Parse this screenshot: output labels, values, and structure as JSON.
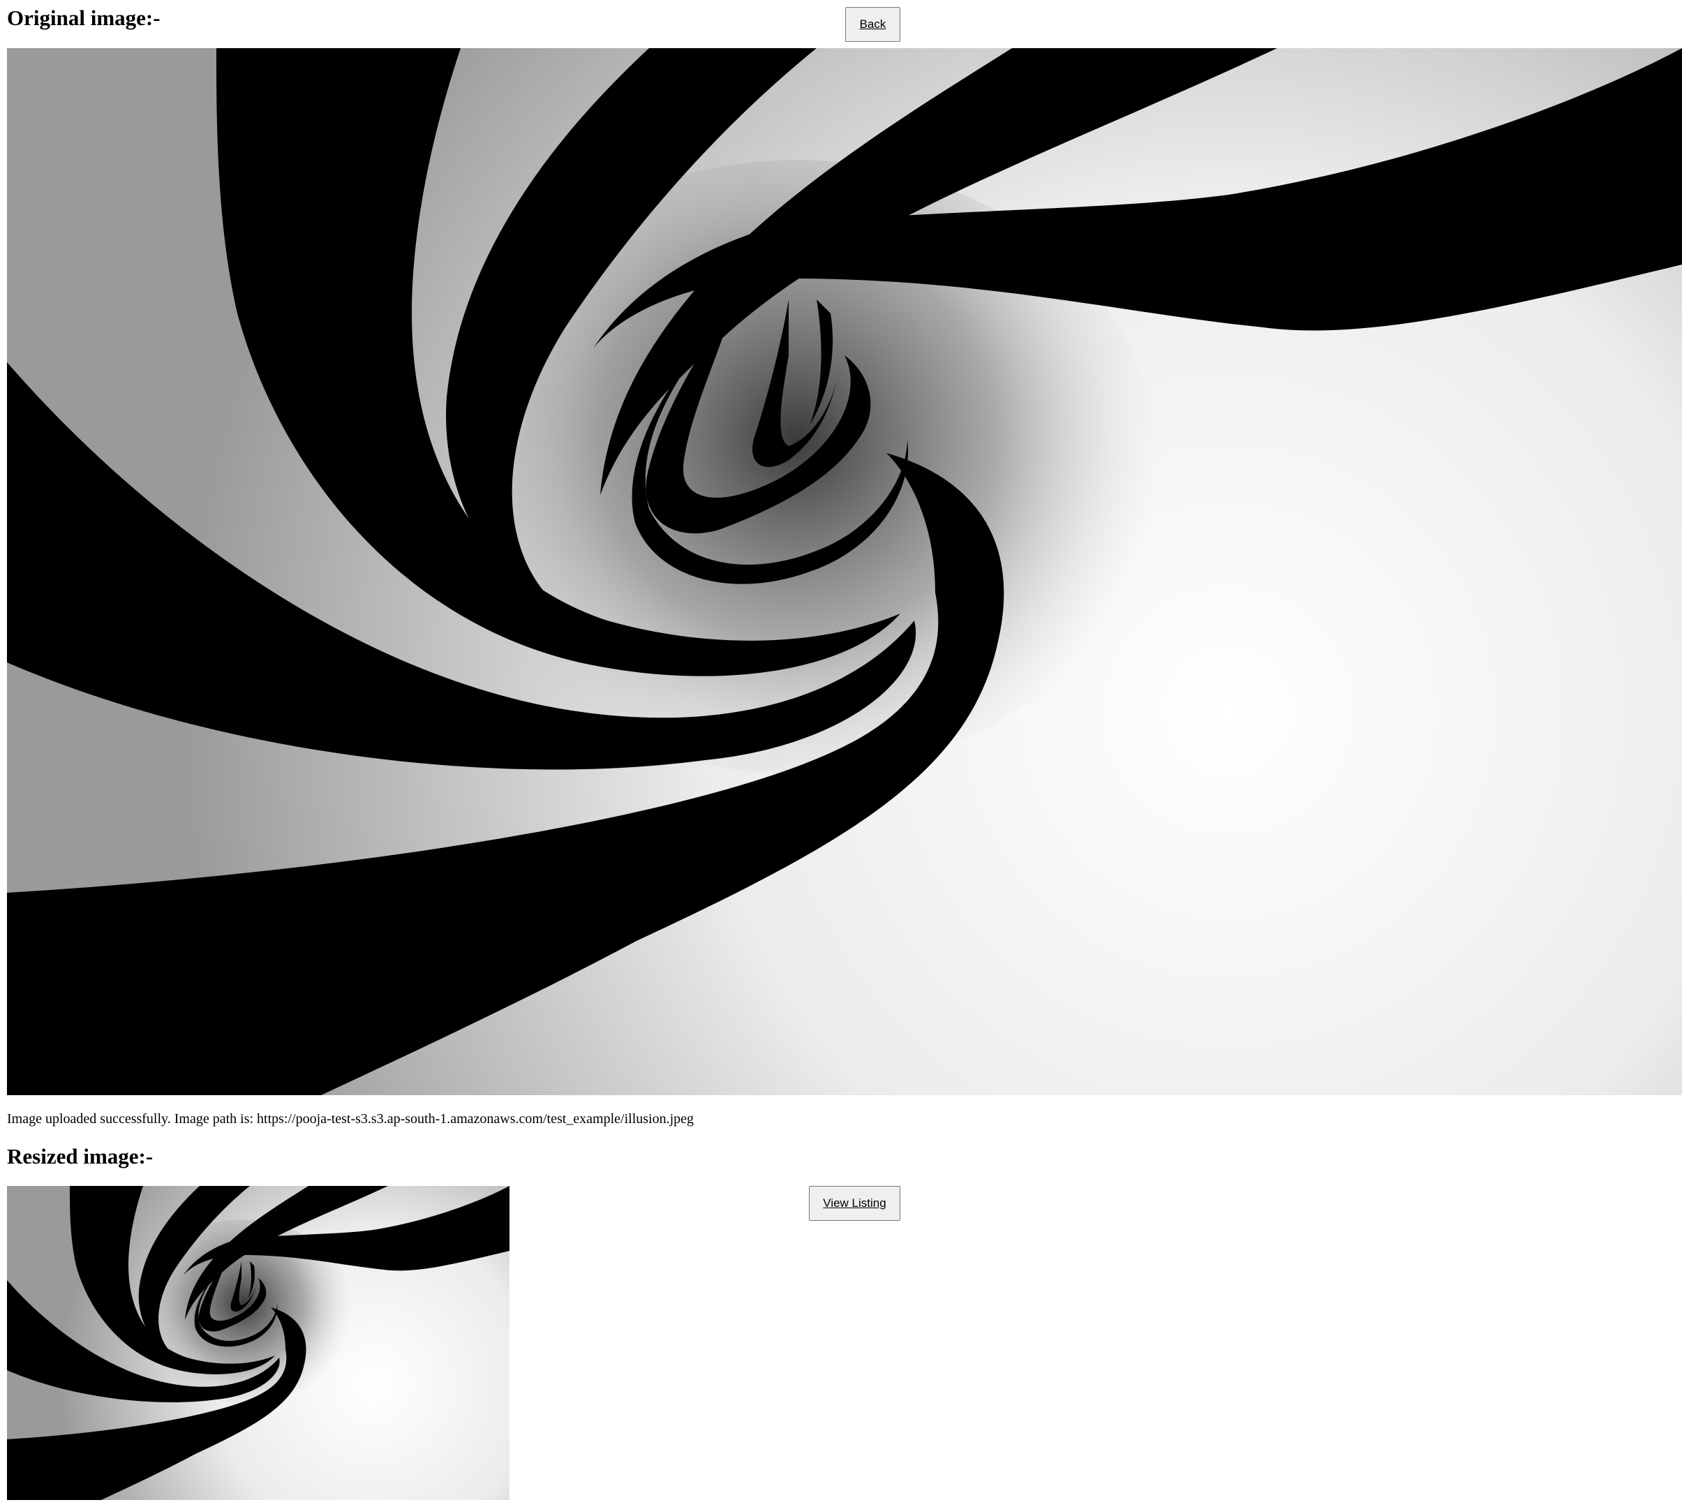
{
  "original_section": {
    "heading": "Original image:-",
    "image_icon": "spiral-illusion-image"
  },
  "back_button": {
    "label": "Back"
  },
  "status": {
    "message": "Image uploaded successfully. Image path is: https://pooja-test-s3.s3.ap-south-1.amazonaws.com/test_example/illusion.jpeg"
  },
  "resized_section": {
    "heading": "Resized image:-",
    "image_icon": "spiral-illusion-image"
  },
  "view_listing_button": {
    "label": "View Listing"
  },
  "colors": {
    "stripe_dark": "#000000",
    "stripe_light": "#e6e6e6",
    "button_bg": "#efefef",
    "button_border": "#767676"
  }
}
